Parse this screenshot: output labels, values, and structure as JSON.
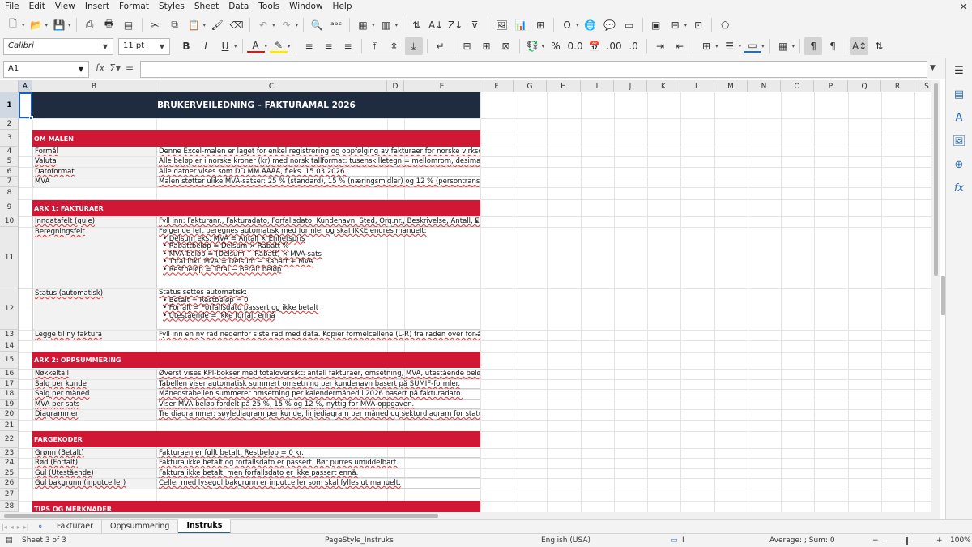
{
  "menu": [
    "File",
    "Edit",
    "View",
    "Insert",
    "Format",
    "Styles",
    "Sheet",
    "Data",
    "Tools",
    "Window",
    "Help"
  ],
  "font": {
    "name": "Calibri",
    "size": "11 pt"
  },
  "namebox": "A1",
  "columns": [
    "A",
    "B",
    "C",
    "D",
    "E",
    "F",
    "G",
    "H",
    "I",
    "J",
    "K",
    "L",
    "M",
    "N",
    "O",
    "P",
    "Q",
    "R",
    "S"
  ],
  "rows": [
    "1",
    "2",
    "3",
    "4",
    "5",
    "6",
    "7",
    "8",
    "9",
    "10",
    "11",
    "12",
    "13",
    "14",
    "15",
    "16",
    "17",
    "18",
    "19",
    "20",
    "21",
    "22",
    "23",
    "24",
    "25",
    "26",
    "27",
    "28"
  ],
  "title": "BRUKERVEILEDNING – FAKTURAMAL 2026",
  "sections": {
    "om": "OM MALEN",
    "ark1": "ARK 1: FAKTURAER",
    "ark2": "ARK 2: OPPSUMMERING",
    "farge": "FARGEKODER",
    "tips": "TIPS OG MERKNADER"
  },
  "om_rows": [
    {
      "label": "Formål",
      "value": "Denne Excel-malen er laget for enkel registrering og oppfølging av fakturaer for norske virksomheter."
    },
    {
      "label": "Valuta",
      "value": "Alle beløp er i norske kroner (kr) med norsk tallformat: tusenskilletegn = mellomrom, desimalskilletegn = komma."
    },
    {
      "label": "Datoformat",
      "value": "Alle datoer vises som DD.MM.ÅÅÅÅ, f.eks. 15.03.2026."
    },
    {
      "label": "MVA",
      "value": "Malen støtter ulike MVA-satser: 25 % (standard), 15 % (næringsmidler) og 12 % (persontransport/overnatting)."
    }
  ],
  "ark1_rows": {
    "inndata": {
      "label": "Inndatafelt (gule)",
      "value": "Fyll inn: Fakturanr., Fakturadato, Forfallsdato, Kundenavn, Sted, Org.nr., Beskrivelse, Antall, Enhetspris eks. MVA"
    },
    "beregning": {
      "label": "Beregningsfelt",
      "head": "Følgende felt beregnes automatisk med formler og skal IKKE endres manuelt:",
      "items": [
        "• Delsum eks. MVA = Antall × Enhetspris",
        "• Rabattbeløp = Delsum × Rabatt %",
        "• MVA-beløp = (Delsum − Rabatt) × MVA-sats",
        "• Total inkl. MVA = Delsum − Rabatt + MVA",
        "• Restbeløp = Total − Betalt beløp"
      ]
    },
    "status": {
      "label": "Status (automatisk)",
      "head": "Status settes automatisk:",
      "items": [
        "• Betalt = Restbeløp = 0",
        "• Forfalt = Forfallsdato passert og ikke betalt",
        "• Utestående = ikke forfalt ennå"
      ]
    },
    "legg": {
      "label": "Legge til ny faktura",
      "value": "Fyll inn en ny rad nedenfor siste rad med data. Kopier formelcellene (L-R) fra raden over for å få med alle"
    }
  },
  "ark2_rows": [
    {
      "label": "Nøkkeltall",
      "value": "Øverst vises KPI-bokser med totaloversikt: antall fakturaer, omsetning, MVA, utestående beløp osv."
    },
    {
      "label": "Salg per kunde",
      "value": "Tabellen viser automatisk summert omsetning per kundenavn basert på SUMIF-formler."
    },
    {
      "label": "Salg per måned",
      "value": "Månedstabellen summerer omsetning per kalendermåned i 2026 basert på fakturadato."
    },
    {
      "label": "MVA per sats",
      "value": "Viser MVA-beløp fordelt på 25 %, 15 % og 12 %, nyttig for MVA-oppgaven."
    },
    {
      "label": "Diagrammer",
      "value": "Tre diagrammer: søylediagram per kunde, linjediagram per måned og sektordiagram for statusfordeling."
    }
  ],
  "farge_rows": [
    {
      "label": "Grønn (Betalt)",
      "value": "Fakturaen er fullt betalt, Restbeløp = 0 kr."
    },
    {
      "label": "Rød (Forfalt)",
      "value": "Faktura ikke betalt og forfallsdato er passert. Bør purres umiddelbart."
    },
    {
      "label": "Gul (Utestående)",
      "value": "Faktura ikke betalt, men forfallsdato er ikke passert ennå."
    },
    {
      "label": "Gul bakgrunn (inputceller)",
      "value": "Celler med lysegul bakgrunn er inputceller som skal fylles ut manuelt."
    }
  ],
  "tabs": [
    "Fakturaer",
    "Oppsummering",
    "Instruks"
  ],
  "status": {
    "sheet": "Sheet 3 of 3",
    "pagestyle": "PageStyle_Instruks",
    "language": "English (USA)",
    "summary": "Average: ; Sum: 0",
    "zoom": "100%"
  }
}
